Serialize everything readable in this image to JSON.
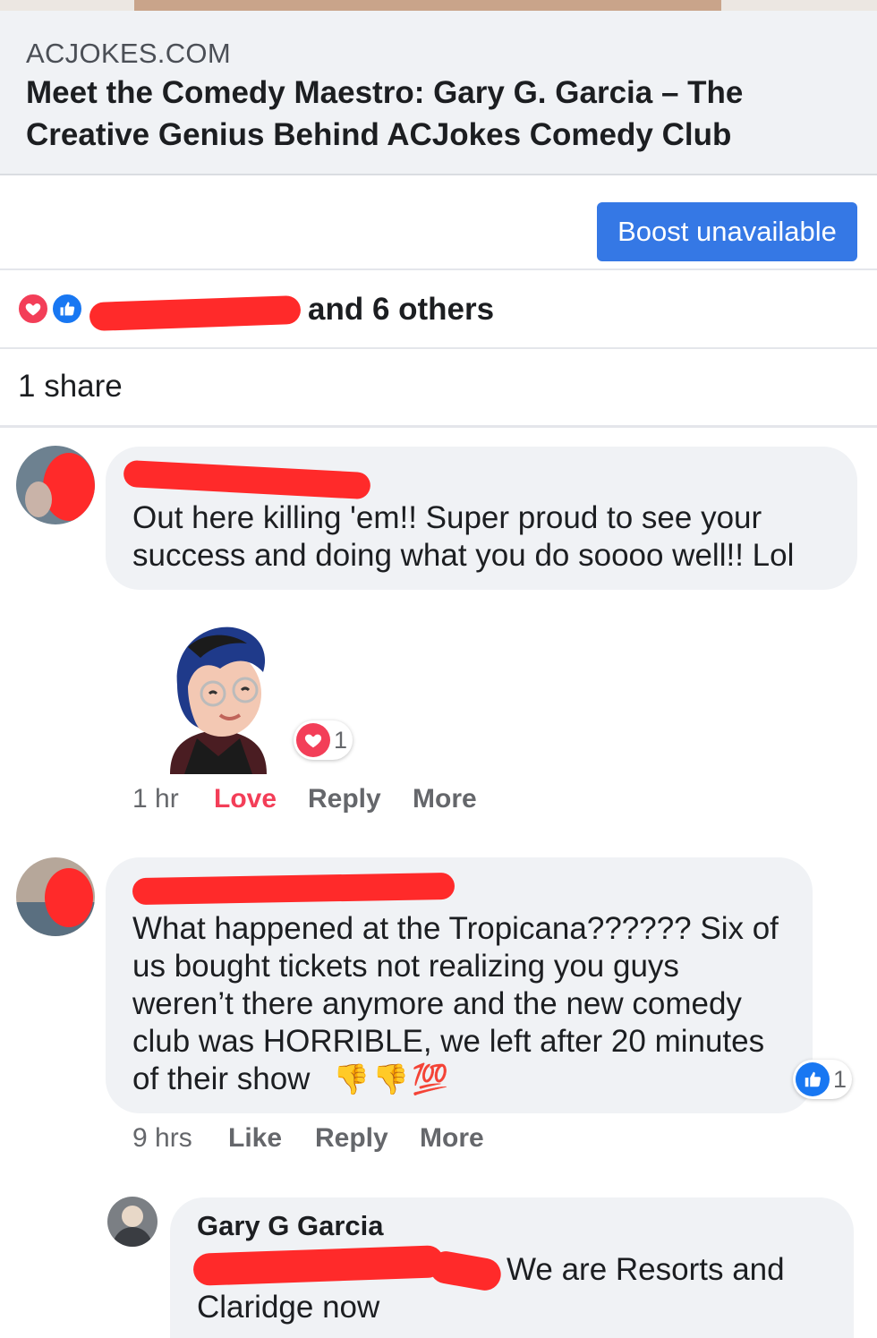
{
  "link_preview": {
    "domain": "ACJOKES.COM",
    "title": "Meet the Comedy Maestro: Gary G. Garcia – The Creative Genius Behind ACJokes Comedy Club"
  },
  "boost": {
    "label": "Boost unavailable"
  },
  "reactions": {
    "summary_suffix": "and 6 others",
    "types": [
      "love-icon",
      "like-icon"
    ]
  },
  "shares": {
    "label": "1 share"
  },
  "comments": [
    {
      "text": "Out here killing 'em!! Super proud to see your success and doing what you do soooo well!! Lol",
      "sticker": "avatar-sticker",
      "reaction_count": "1",
      "time": "1 hr",
      "reaction_action": "Love",
      "reply_label": "Reply",
      "more_label": "More"
    },
    {
      "text_line1": "What happened at the Tropicana?????? Six of",
      "text_line2": "us bought tickets not realizing you guys",
      "text_line3": "weren’t there anymore and the new comedy",
      "text_line4": "club was HORRIBLE, we left after 20 minutes",
      "text_line5": "of their show",
      "emojis": [
        "👎",
        "👎",
        "💯"
      ],
      "reaction_count": "1",
      "time": "9 hrs",
      "like_label": "Like",
      "reply_label": "Reply",
      "more_label": "More"
    }
  ],
  "reply": {
    "author": "Gary G Garcia",
    "text_tail": "We are Resorts and",
    "text_line2": "Claridge now"
  },
  "colors": {
    "accent": "#3578e5",
    "love": "#f33e58",
    "like": "#1877f2",
    "redaction": "#ff2a2a",
    "bubble": "#f0f2f5"
  }
}
